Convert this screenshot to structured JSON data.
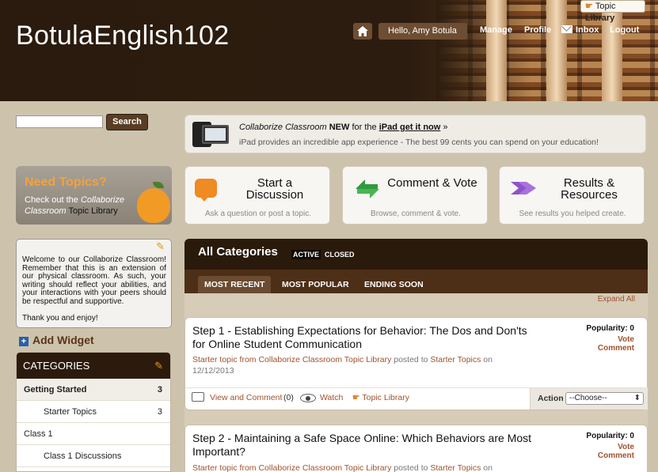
{
  "header": {
    "site_title": "BotulaEnglish102",
    "greeting": "Hello, Amy Botula",
    "nav": {
      "manage": "Manage",
      "profile": "Profile",
      "inbox": "Inbox",
      "logout": "Logout"
    },
    "topic_library_prefix": "Topic",
    "topic_library_bold": "Library"
  },
  "search": {
    "button": "Search",
    "value": ""
  },
  "need_topics": {
    "title": "Need Topics?",
    "text_prefix": "Check out the",
    "text_italic": "Collaborize Classroom",
    "text_suffix": "Topic Library"
  },
  "promo": {
    "italic": "Collaborize Classroom",
    "new": "NEW",
    "for_the": "for the",
    "link": "iPad get it now",
    "arrow": "»",
    "desc": "iPad provides an incredible app experience - The best 99 cents you can spend on your education!"
  },
  "actions": [
    {
      "title": "Start a Discussion",
      "sub": "Ask a question or post a topic."
    },
    {
      "title": "Comment & Vote",
      "sub": "Browse, comment & vote."
    },
    {
      "title": "Results & Resources",
      "sub": "See results you helped create."
    }
  ],
  "welcome": {
    "text": "Welcome to our Collaborize Classroom! Remember that this is an extension of our physical classroom. As such, your writing should reflect your abilities, and your interactions with your peers should be respectful and supportive.",
    "thanks": "Thank you and enjoy!"
  },
  "add_widget": "Add Widget",
  "categories": {
    "title": "CATEGORIES",
    "items": [
      {
        "label": "Getting Started",
        "count": "3",
        "sub": false,
        "bold": true
      },
      {
        "label": "Starter Topics",
        "count": "3",
        "sub": true,
        "bold": false
      },
      {
        "label": "Class 1",
        "count": "",
        "sub": false,
        "bold": false
      },
      {
        "label": "Class 1 Discussions",
        "count": "",
        "sub": true,
        "bold": false
      }
    ]
  },
  "feed": {
    "title": "All Categories",
    "filter_active": "ACTIVE",
    "filter_closed": "CLOSED",
    "tabs": [
      "MOST RECENT",
      "MOST POPULAR",
      "ENDING SOON"
    ],
    "expand_all": "Expand All",
    "posts": [
      {
        "title": "Step 1 - Establishing Expectations for Behavior: The Dos and Don'ts for Online Student Communication",
        "meta_prefix": "Starter topic from Collaborize Classroom Topic Library",
        "posted_to": "posted to",
        "category": "Starter Topics",
        "on": "on",
        "date": "12/12/2013",
        "popularity": "Popularity: 0",
        "vote": "Vote",
        "comment": "Comment",
        "view_comment": "View and Comment",
        "count": "(0)",
        "watch": "Watch",
        "topic_library": "Topic Library",
        "action": "Action",
        "choose": "--Choose--"
      },
      {
        "title": "Step 2 - Maintaining a Safe Space Online: Which Behaviors are Most Important?",
        "meta_prefix": "Starter topic from Collaborize Classroom Topic Library",
        "posted_to": "posted to",
        "category": "Starter Topics",
        "on": "on",
        "popularity": "Popularity: 0",
        "vote": "Vote",
        "comment": "Comment"
      }
    ]
  }
}
